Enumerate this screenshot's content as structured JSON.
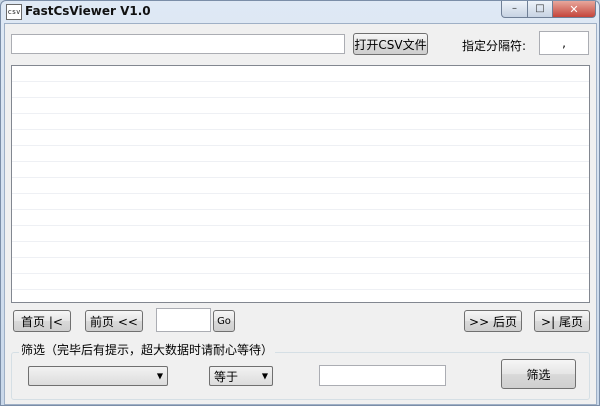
{
  "window": {
    "title": "FastCsViewer V1.0",
    "app_icon_text": "csv",
    "minimize_glyph": "–",
    "maximize_glyph": "□",
    "close_glyph": "✕"
  },
  "toolbar": {
    "file_path_value": "",
    "open_csv_label": "打开CSV文件",
    "delimiter_label": "指定分隔符:",
    "delimiter_value": ","
  },
  "grid": {
    "rows": []
  },
  "pager": {
    "first_label": "首页 |<",
    "prev_label": "前页 <<",
    "page_value": "",
    "go_label": "Go",
    "next_label": ">> 后页",
    "last_label": ">| 尾页"
  },
  "filter": {
    "group_title": "筛选（完毕后有提示，超大数据时请耐心等待）",
    "column_selected": "",
    "operator_selected": "等于",
    "value": "",
    "filter_button_label": "筛选"
  },
  "icons": {
    "dropdown_arrow": "▼"
  }
}
